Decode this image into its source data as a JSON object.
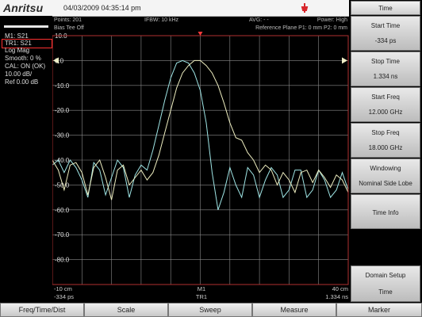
{
  "header": {
    "brand": "Anritsu",
    "datetime": "04/03/2009 04:35:14 pm"
  },
  "status": {
    "points": "Points: 201",
    "ifbw": "IFBW: 10 kHz",
    "avg": "AVG: - -",
    "power": "Power: High",
    "bias_tee": "Bias Tee Off",
    "reference_plane": "Reference Plane P1: 0 mm P2: 0 mm"
  },
  "left_panel": {
    "lines": [
      "M1: S21",
      "TR1: S21",
      "Log Mag",
      "Smooth: 0 %",
      "CAL: ON (OK)",
      "10.00 dB/",
      "Ref 0.00 dB"
    ]
  },
  "chart_data": {
    "type": "line",
    "y_tick_labels": [
      "10.0",
      "0.0",
      "-10.0",
      "-20.0",
      "-30.0",
      "-40.0",
      "-50.0",
      "-60.0",
      "-70.0",
      "-80.0"
    ],
    "ylim": [
      -90,
      10
    ],
    "xlim": [
      -10,
      40
    ],
    "x_unit": "cm",
    "x_start_label": "-10 cm",
    "x_start_time": "-334 ps",
    "x_end_label": "40 cm",
    "x_end_time": "1.334 ns",
    "marker_label": "M1",
    "trace_label": "TR1",
    "grid": true,
    "series": [
      {
        "color": "#9fe6e6",
        "x": [
          -10,
          -9,
          -8,
          -7,
          -6,
          -5,
          -4,
          -3,
          -2,
          -1,
          0,
          1,
          2,
          3,
          4,
          5,
          6,
          7,
          8,
          9,
          10,
          11,
          12,
          13,
          14,
          15,
          16,
          17,
          18,
          19,
          20,
          21,
          22,
          23,
          24,
          25,
          26,
          27,
          28,
          29,
          30,
          31,
          32,
          33,
          34,
          35,
          36,
          37,
          38,
          39,
          40
        ],
        "y": [
          -42,
          -40,
          -45,
          -40,
          -43,
          -48,
          -55,
          -41,
          -44,
          -54,
          -47,
          -40,
          -43,
          -55,
          -46,
          -42,
          -44,
          -36,
          -26,
          -16,
          -7,
          -1,
          0,
          -1,
          -5,
          -12,
          -25,
          -45,
          -60,
          -53,
          -43,
          -50,
          -55,
          -43,
          -46,
          -55,
          -48,
          -43,
          -46,
          -55,
          -52,
          -44,
          -44,
          -55,
          -52,
          -44,
          -48,
          -55,
          -52,
          -45,
          -52
        ]
      },
      {
        "color": "#eeeec0",
        "x": [
          -10,
          -9,
          -8,
          -7,
          -6,
          -5,
          -4,
          -3,
          -2,
          -1,
          0,
          1,
          2,
          3,
          4,
          5,
          6,
          7,
          8,
          9,
          10,
          11,
          12,
          13,
          14,
          15,
          16,
          17,
          18,
          19,
          20,
          21,
          22,
          23,
          24,
          25,
          26,
          27,
          28,
          29,
          30,
          31,
          32,
          33,
          34,
          35,
          36,
          37,
          38,
          39,
          40
        ],
        "y": [
          -40,
          -44,
          -52,
          -42,
          -41,
          -45,
          -54,
          -43,
          -40,
          -47,
          -56,
          -44,
          -42,
          -50,
          -47,
          -44,
          -48,
          -45,
          -38,
          -29,
          -20,
          -11,
          -5,
          -2,
          0,
          0,
          -2,
          -5,
          -10,
          -17,
          -25,
          -31,
          -32,
          -37,
          -40,
          -45,
          -42,
          -44,
          -50,
          -45,
          -48,
          -53,
          -45,
          -44,
          -49,
          -44,
          -47,
          -51,
          -46,
          -48,
          -53
        ]
      }
    ]
  },
  "menu": {
    "title": "Time",
    "buttons": [
      {
        "label": "Start Time",
        "value": "-334 ps"
      },
      {
        "label": "Stop Time",
        "value": "1.334 ns"
      },
      {
        "label": "Start Freq",
        "value": "12.000 GHz"
      },
      {
        "label": "Stop Freq",
        "value": "18.000 GHz"
      },
      {
        "label": "Windowing",
        "value": "Nominal Side Lobe"
      },
      {
        "label": "Time Info",
        "value": ""
      },
      {
        "label": "Domain Setup",
        "value": "Time"
      }
    ]
  },
  "bottom_menu": [
    "Freq/Time/Dist",
    "Scale",
    "Sweep",
    "Measure",
    "Marker"
  ],
  "colors": {
    "grid": "#8a8a8a",
    "border": "#b03030",
    "text": "#dddddd",
    "reference_marker": "#f0f0c8"
  }
}
